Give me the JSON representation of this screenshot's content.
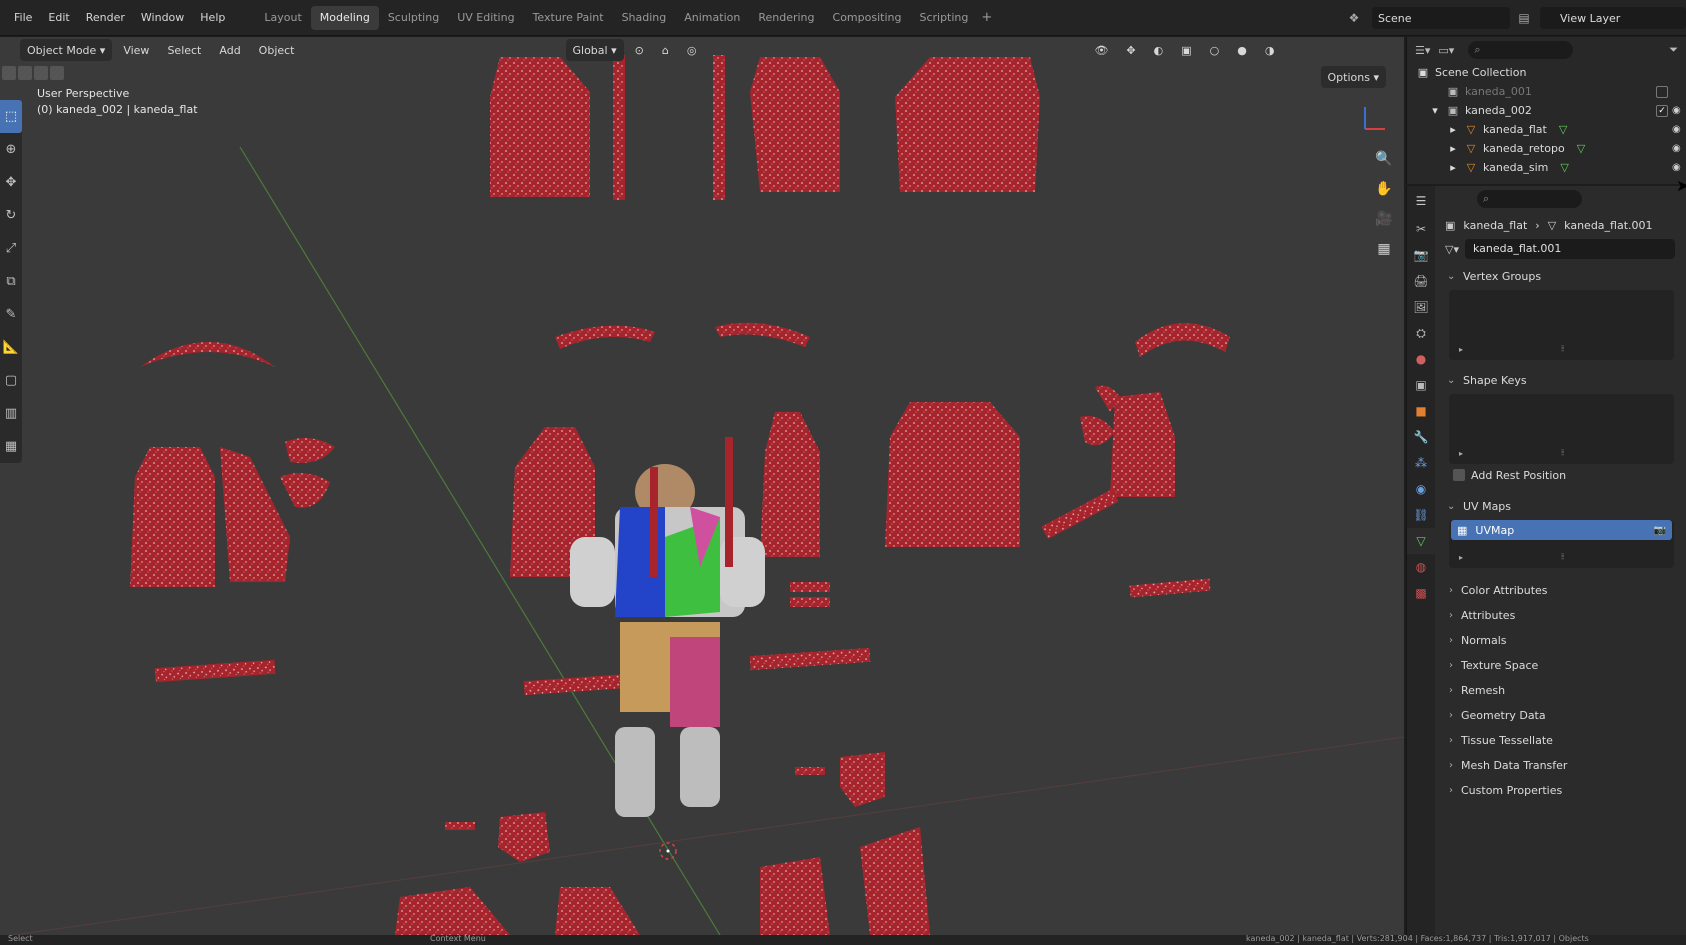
{
  "menu": [
    "File",
    "Edit",
    "Render",
    "Window",
    "Help"
  ],
  "workspaces": [
    {
      "label": "Layout",
      "active": false
    },
    {
      "label": "Modeling",
      "active": true
    },
    {
      "label": "Sculpting",
      "active": false
    },
    {
      "label": "UV Editing",
      "active": false
    },
    {
      "label": "Texture Paint",
      "active": false
    },
    {
      "label": "Shading",
      "active": false
    },
    {
      "label": "Animation",
      "active": false
    },
    {
      "label": "Rendering",
      "active": false
    },
    {
      "label": "Compositing",
      "active": false
    },
    {
      "label": "Scripting",
      "active": false
    }
  ],
  "scene": {
    "label": "Scene"
  },
  "view_layer": {
    "label": "View Layer"
  },
  "viewport": {
    "mode": "Object Mode",
    "header_menus": [
      "View",
      "Select",
      "Add",
      "Object"
    ],
    "transform_orientation": "Global",
    "options_label": "Options",
    "perspective": "User Perspective",
    "selection_info": "(0) kaneda_002 | kaneda_flat"
  },
  "outliner": {
    "root": "Scene Collection",
    "rows": [
      {
        "label": "kaneda_001",
        "dim": true,
        "indent": 0
      },
      {
        "label": "kaneda_002",
        "dim": false,
        "indent": 0
      },
      {
        "label": "kaneda_flat",
        "dim": false,
        "indent": 1
      },
      {
        "label": "kaneda_retopo",
        "dim": false,
        "indent": 1
      },
      {
        "label": "kaneda_sim",
        "dim": false,
        "indent": 1
      }
    ]
  },
  "properties": {
    "breadcrumb_object": "kaneda_flat",
    "breadcrumb_mesh": "kaneda_flat.001",
    "mesh_name": "kaneda_flat.001",
    "vertex_groups": "Vertex Groups",
    "shape_keys": "Shape Keys",
    "add_rest_position": "Add Rest Position",
    "uv_maps": "UV Maps",
    "uv_map_item": "UVMap",
    "collapsed_panels": [
      "Color Attributes",
      "Attributes",
      "Normals",
      "Texture Space",
      "Remesh",
      "Geometry Data",
      "Tissue Tessellate",
      "Mesh Data Transfer",
      "Custom Properties"
    ]
  },
  "status": {
    "left": "Select",
    "center": "Context Menu",
    "right": "kaneda_002 | kaneda_flat | Verts:281,904 | Faces:1,864,737 | Tris:1,917,017 | Objects"
  },
  "colors": {
    "accent": "#4772b3",
    "viewport_bg": "#3a3a3a",
    "cloth_red": "#a8242c"
  }
}
